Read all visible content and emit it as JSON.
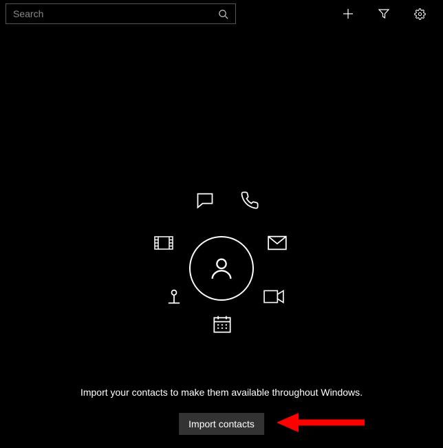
{
  "search": {
    "placeholder": "Search"
  },
  "empty_state": {
    "prompt": "Import your contacts to make them available throughout Windows.",
    "button": "Import contacts"
  }
}
